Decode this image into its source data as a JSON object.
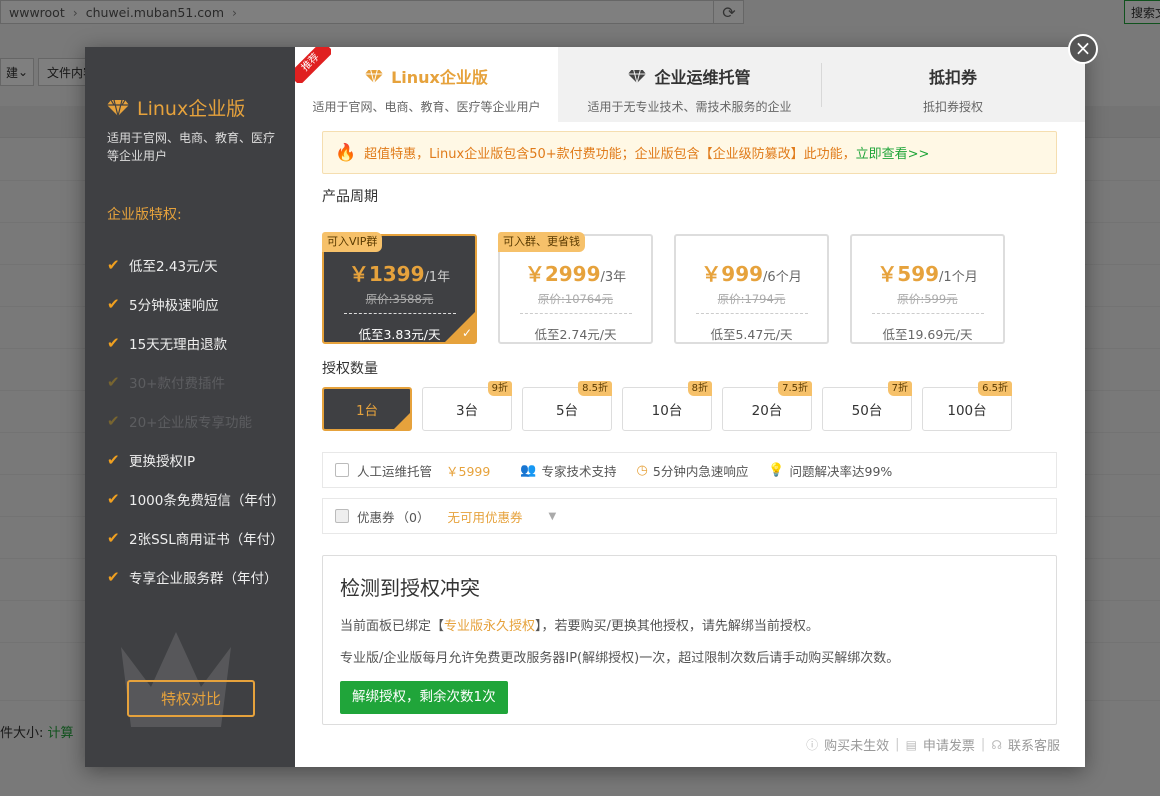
{
  "browser": {
    "breadcrumb": [
      "wwwroot",
      "chuwei.muban51.com"
    ],
    "search_label": "搜索文",
    "toolbar": [
      "建",
      "文件内容"
    ]
  },
  "background": {
    "size_label": "件大小:",
    "calc_link": "计算"
  },
  "sidebar": {
    "title": "Linux企业版",
    "desc": "适用于官网、电商、教育、医疗等企业用户",
    "privileges_title": "企业版特权:",
    "items": [
      {
        "label": "低至2.43元/天",
        "enabled": true
      },
      {
        "label": "5分钟极速响应",
        "enabled": true
      },
      {
        "label": "15天无理由退款",
        "enabled": true
      },
      {
        "label": "30+款付费插件",
        "enabled": false
      },
      {
        "label": "20+企业版专享功能",
        "enabled": false
      },
      {
        "label": "更换授权IP",
        "enabled": true
      },
      {
        "label": "1000条免费短信（年付）",
        "enabled": true
      },
      {
        "label": "2张SSL商用证书（年付）",
        "enabled": true
      },
      {
        "label": "专享企业服务群（年付）",
        "enabled": true
      }
    ],
    "compare_button": "特权对比"
  },
  "tabs": [
    {
      "name": "Linux企业版",
      "desc": "适用于官网、电商、教育、医疗等企业用户",
      "active": true,
      "ribbon": "推荐"
    },
    {
      "name": "企业运维托管",
      "desc": "适用于无专业技术、需技术服务的企业",
      "active": false
    },
    {
      "name": "抵扣券",
      "desc": "抵扣券授权",
      "active": false
    }
  ],
  "notice": {
    "text": "超值特惠，Linux企业版包含50+款付费功能；企业版包含【企业级防篡改】此功能，",
    "link": "立即查看>>"
  },
  "period_label": "产品周期",
  "plans": [
    {
      "badge": "可入VIP群",
      "price": "￥1399",
      "per": "/1年",
      "orig": "原价:3588元",
      "daily": "低至3.83元/天",
      "selected": true
    },
    {
      "badge": "可入群、更省钱",
      "price": "￥2999",
      "per": "/3年",
      "orig": "原价:10764元",
      "daily": "低至2.74元/天",
      "selected": false
    },
    {
      "badge": "",
      "price": "￥999",
      "per": "/6个月",
      "orig": "原价:1794元",
      "daily": "低至5.47元/天",
      "selected": false
    },
    {
      "badge": "",
      "price": "￥599",
      "per": "/1个月",
      "orig": "原价:599元",
      "daily": "低至19.69元/天",
      "selected": false
    }
  ],
  "quantity_label": "授权数量",
  "quantities": [
    {
      "label": "1台",
      "discount": "",
      "selected": true
    },
    {
      "label": "3台",
      "discount": "9折",
      "selected": false
    },
    {
      "label": "5台",
      "discount": "8.5折",
      "selected": false
    },
    {
      "label": "10台",
      "discount": "8折",
      "selected": false
    },
    {
      "label": "20台",
      "discount": "7.5折",
      "selected": false
    },
    {
      "label": "50台",
      "discount": "7折",
      "selected": false
    },
    {
      "label": "100台",
      "discount": "6.5折",
      "selected": false
    }
  ],
  "ops": {
    "label": "人工运维托管",
    "price": "￥5999",
    "features": [
      "专家技术支持",
      "5分钟内急速响应",
      "问题解决率达99%"
    ]
  },
  "coupon": {
    "label": "优惠券",
    "count": "（0）",
    "select": "无可用优惠券"
  },
  "conflict": {
    "title": "检测到授权冲突",
    "p1_before": "当前面板已绑定【",
    "p1_highlight": "专业版永久授权",
    "p1_after": "】，若要购买/更换其他授权，请先解绑当前授权。",
    "p2": "专业版/企业版每月允许免费更改服务器IP(解绑授权)一次，超过限制次数后请手动购买解绑次数。",
    "button": "解绑授权，剩余次数1次"
  },
  "footer": [
    "购买未生效",
    "申请发票",
    "联系客服"
  ],
  "colors": {
    "accent": "#e6a23c",
    "green": "#20a53a",
    "sidebar": "#3f4043",
    "red": "#e02020"
  }
}
